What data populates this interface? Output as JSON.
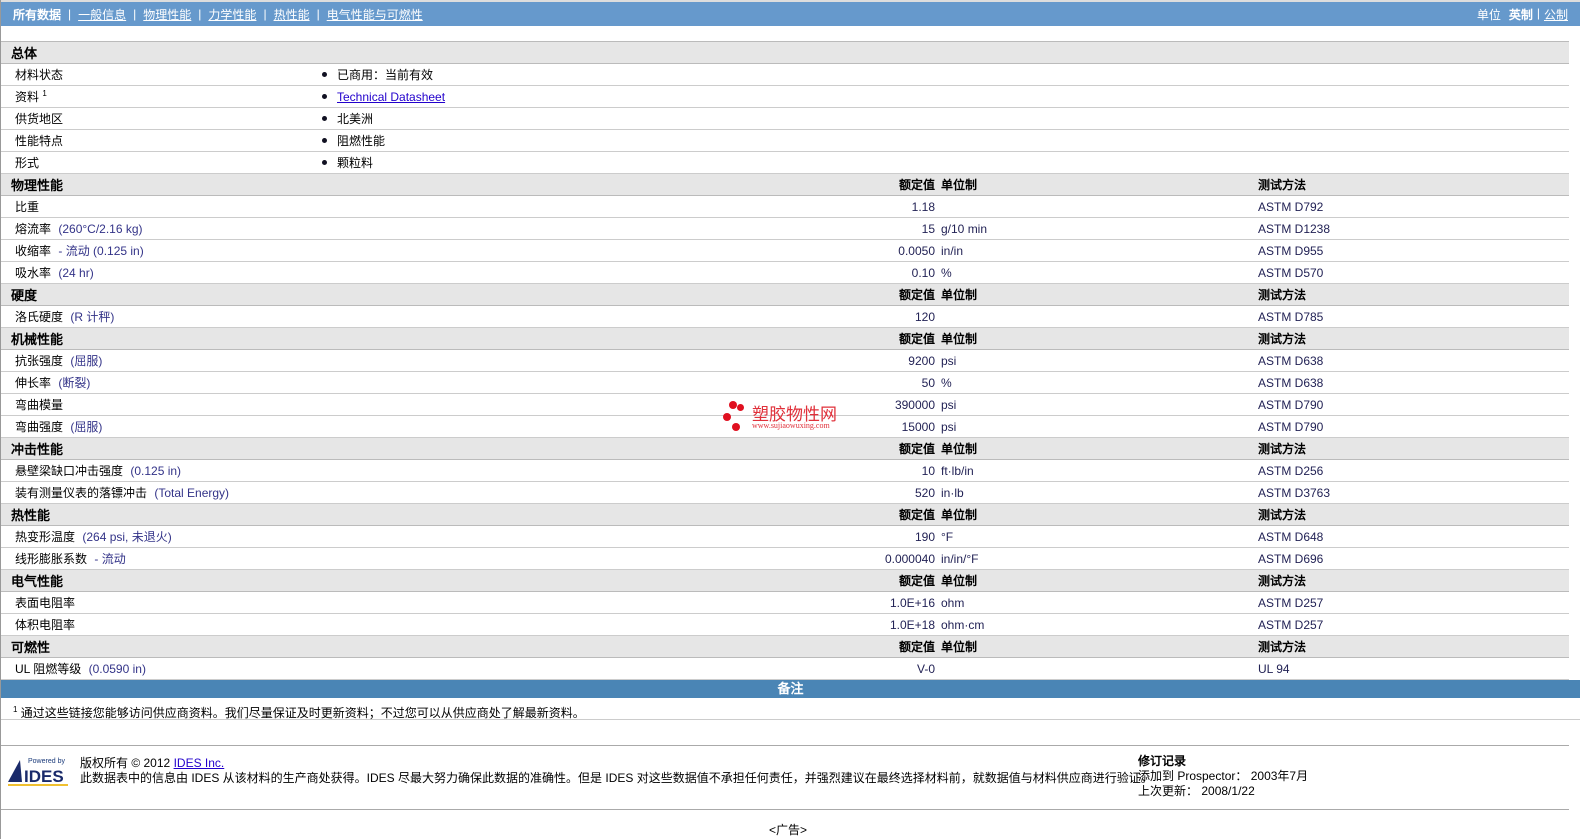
{
  "nav": {
    "tabs": [
      "所有数据",
      "一般信息",
      "物理性能",
      "力学性能",
      "热性能",
      "电气性能与可燃性"
    ],
    "unit_label": "单位",
    "unit_active": "英制",
    "unit_other": "公制"
  },
  "header_cols": {
    "value": "额定值",
    "unit": "单位制",
    "method": "测试方法"
  },
  "general": {
    "title": "总体",
    "rows": [
      {
        "label": "材料状态",
        "value": "已商用：当前有效"
      },
      {
        "label": "资料",
        "sup": "1",
        "value": "Technical Datasheet",
        "link": true
      },
      {
        "label": "供货地区",
        "value": "北美洲"
      },
      {
        "label": "性能特点",
        "value": "阻燃性能"
      },
      {
        "label": "形式",
        "value": "颗粒料"
      }
    ]
  },
  "sections": [
    {
      "title": "物理性能",
      "rows": [
        {
          "label": "比重",
          "cond": "",
          "value": "1.18",
          "unit": "",
          "method": "ASTM D792"
        },
        {
          "label": "熔流率",
          "cond": "(260°C/2.16 kg)",
          "value": "15",
          "unit": "g/10 min",
          "method": "ASTM D1238"
        },
        {
          "label": "收缩率",
          "cond": "- 流动  (0.125 in)",
          "value": "0.0050",
          "unit": "in/in",
          "method": "ASTM D955"
        },
        {
          "label": "吸水率",
          "cond": "(24 hr)",
          "value": "0.10",
          "unit": "%",
          "method": "ASTM D570"
        }
      ]
    },
    {
      "title": "硬度",
      "rows": [
        {
          "label": "洛氏硬度",
          "cond": "(R 计秤)",
          "value": "120",
          "unit": "",
          "method": "ASTM D785"
        }
      ]
    },
    {
      "title": "机械性能",
      "rows": [
        {
          "label": "抗张强度",
          "cond": "(屈服)",
          "value": "9200",
          "unit": "psi",
          "method": "ASTM D638"
        },
        {
          "label": "伸长率",
          "cond": "(断裂)",
          "value": "50",
          "unit": "%",
          "method": "ASTM D638"
        },
        {
          "label": "弯曲模量",
          "cond": "",
          "value": "390000",
          "unit": "psi",
          "method": "ASTM D790"
        },
        {
          "label": "弯曲强度",
          "cond": "(屈服)",
          "value": "15000",
          "unit": "psi",
          "method": "ASTM D790"
        }
      ]
    },
    {
      "title": "冲击性能",
      "rows": [
        {
          "label": "悬壁梁缺口冲击强度",
          "cond": "(0.125 in)",
          "value": "10",
          "unit": "ft·lb/in",
          "method": "ASTM D256"
        },
        {
          "label": "装有测量仪表的落镖冲击",
          "cond": "(Total Energy)",
          "value": "520",
          "unit": "in·lb",
          "method": "ASTM D3763"
        }
      ]
    },
    {
      "title": "热性能",
      "rows": [
        {
          "label": "热变形温度",
          "cond": "(264 psi, 未退火)",
          "value": "190",
          "unit": "°F",
          "method": "ASTM D648"
        },
        {
          "label": "线形膨胀系数",
          "cond": "- 流动",
          "value": "0.000040",
          "unit": "in/in/°F",
          "method": "ASTM D696"
        }
      ]
    },
    {
      "title": "电气性能",
      "rows": [
        {
          "label": "表面电阻率",
          "cond": "",
          "value": "1.0E+16",
          "unit": "ohm",
          "method": "ASTM D257"
        },
        {
          "label": "体积电阻率",
          "cond": "",
          "value": "1.0E+18",
          "unit": "ohm·cm",
          "method": "ASTM D257"
        }
      ]
    },
    {
      "title": "可燃性",
      "rows": [
        {
          "label": "UL 阻燃等级",
          "cond": "(0.0590 in)",
          "value": "V-0",
          "unit": "",
          "method": "UL 94"
        }
      ]
    }
  ],
  "notes": {
    "title": "备注",
    "sup": "1",
    "text": "通过这些链接您能够访问供应商资料。我们尽量保证及时更新资料；不过您可以从供应商处了解最新资料。"
  },
  "watermark": {
    "name": "塑胶物性网",
    "url": "www.sujiaowuxing.com"
  },
  "footer": {
    "logo_powered": "Powered by",
    "logo_name": "IDES",
    "copyright": "版权所有  © 2012",
    "company_link": "IDES Inc.",
    "disclaimer": "此数据表中的信息由 IDES 从该材料的生产商处获得。IDES 尽最大努力确保此数据的准确性。但是 IDES 对这些数据值不承担任何责任，并强烈建议在最终选择材料前，就数据值与材料供应商进行验证。",
    "revision_title": "修订记录",
    "added_label": "添加到 Prospector：",
    "added_value": "2003年7月",
    "updated_label": "上次更新：",
    "updated_value": "2008/1/22"
  },
  "ad": "<广告>"
}
